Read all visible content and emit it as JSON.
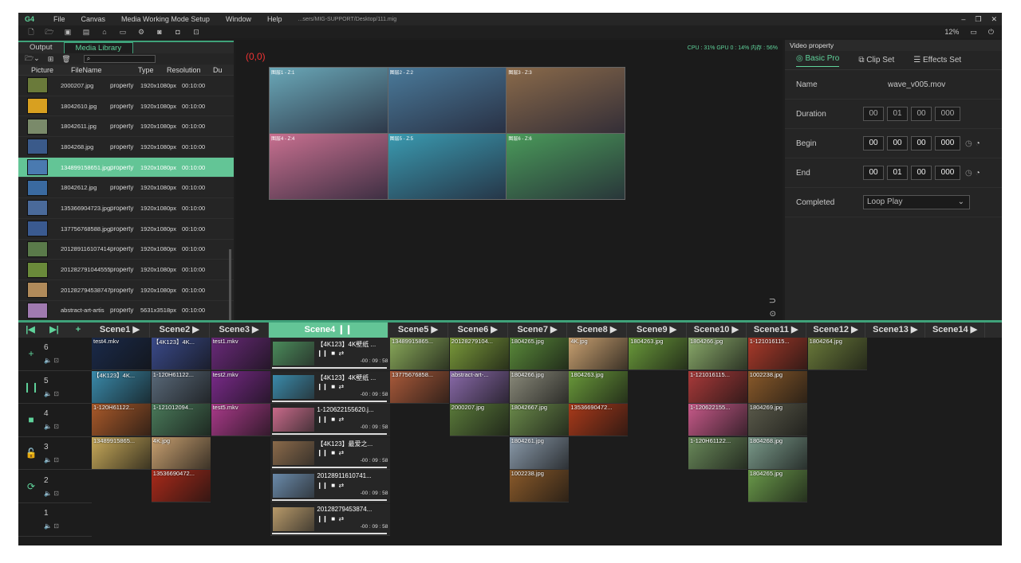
{
  "menu": {
    "app": "G4",
    "items": [
      "File",
      "Canvas",
      "Media Working Mode Setup",
      "Window",
      "Help"
    ],
    "path": "...sers/MIG-SUPPORT/Desktop/111.mig"
  },
  "toolbar": {
    "zoom": "12%"
  },
  "library": {
    "tabs": [
      "Output",
      "Media Library"
    ],
    "columns": [
      "Picture",
      "FileName",
      "Type",
      "Resolution",
      "Du"
    ],
    "rows": [
      {
        "name": "2000207.jpg",
        "type": "property",
        "res": "1920x1080px",
        "dur": "00:10:00",
        "color": "#6a7a3a"
      },
      {
        "name": "18042610.jpg",
        "type": "property",
        "res": "1920x1080px",
        "dur": "00:10:00",
        "color": "#d8a020"
      },
      {
        "name": "18042611.jpg",
        "type": "property",
        "res": "1920x1080px",
        "dur": "00:10:00",
        "color": "#7a8a6a"
      },
      {
        "name": "1804268.jpg",
        "type": "property",
        "res": "1920x1080px",
        "dur": "00:10:00",
        "color": "#3a5a8a"
      },
      {
        "name": "134899158651.jpg",
        "type": "property",
        "res": "1920x1080px",
        "dur": "00:10:00",
        "color": "#4a7ab0"
      },
      {
        "name": "18042612.jpg",
        "type": "property",
        "res": "1920x1080px",
        "dur": "00:10:00",
        "color": "#3a6aa0"
      },
      {
        "name": "135366904723.jpg",
        "type": "property",
        "res": "1920x1080px",
        "dur": "00:10:00",
        "color": "#4a6a9a"
      },
      {
        "name": "137756768588.jpg",
        "type": "property",
        "res": "1920x1080px",
        "dur": "00:10:00",
        "color": "#3a5a90"
      },
      {
        "name": "201289116107414",
        "type": "property",
        "res": "1920x1080px",
        "dur": "00:10:00",
        "color": "#5a7a4a"
      },
      {
        "name": "201282791044555",
        "type": "property",
        "res": "1920x1080px",
        "dur": "00:10:00",
        "color": "#6a8a3a"
      },
      {
        "name": "201282794538747",
        "type": "property",
        "res": "1920x1080px",
        "dur": "00:10:00",
        "color": "#b08a5a"
      },
      {
        "name": "abstract-art-artis",
        "type": "property",
        "res": "5631x3518px",
        "dur": "00:10:00",
        "color": "#a07ab0"
      }
    ]
  },
  "preview": {
    "stats": "CPU : 31%   GPU 0 : 14%   内存 : 56%",
    "origin": "(0,0)",
    "cells": [
      {
        "label": "图层1 - Z:1",
        "color": "#6aa8b8"
      },
      {
        "label": "图层2 - Z:2",
        "color": "#4a7a9a"
      },
      {
        "label": "图层3 - Z:3",
        "color": "#8a6a4a"
      },
      {
        "label": "图层4 - Z:4",
        "color": "#c87090"
      },
      {
        "label": "图层5 - Z:5",
        "color": "#3a9ab0"
      },
      {
        "label": "图层6 - Z:6",
        "color": "#4a9a5a"
      }
    ]
  },
  "property": {
    "title": "Video property",
    "tabs": [
      "Basic Pro",
      "Clip Set",
      "Effects Set"
    ],
    "name_label": "Name",
    "name_value": "wave_v005.mov",
    "duration_label": "Duration",
    "duration": [
      "00",
      "01",
      "00",
      "000"
    ],
    "begin_label": "Begin",
    "begin": [
      "00",
      "00",
      "00",
      "000"
    ],
    "end_label": "End",
    "end": [
      "00",
      "01",
      "00",
      "000"
    ],
    "completed_label": "Completed",
    "completed_value": "Loop Play"
  },
  "timeline": {
    "scenes": [
      "Scene1 ▶",
      "Scene2 ▶",
      "Scene3 ▶",
      "Scene4 ❙❙",
      "Scene5 ▶",
      "Scene6 ▶",
      "Scene7 ▶",
      "Scene8 ▶",
      "Scene9 ▶",
      "Scene10 ▶",
      "Scene11 ▶",
      "Scene12 ▶",
      "Scene13 ▶",
      "Scene14 ▶"
    ],
    "layers": [
      "6",
      "5",
      "4",
      "3",
      "2",
      "1"
    ],
    "clips": [
      {
        "r": 0,
        "c": 0,
        "t": "test4.mkv",
        "col": "#1a2a4a"
      },
      {
        "r": 0,
        "c": 1,
        "t": "【4K123】4K...",
        "col": "#3a4a8a"
      },
      {
        "r": 0,
        "c": 2,
        "t": "test1.mkv",
        "col": "#6a2a7a"
      },
      {
        "r": 0,
        "c": 4,
        "t": "13489915865...",
        "col": "#8aaa5a"
      },
      {
        "r": 0,
        "c": 5,
        "t": "20128279104...",
        "col": "#7a9a3a"
      },
      {
        "r": 0,
        "c": 6,
        "t": "1804265.jpg",
        "col": "#5a8a3a"
      },
      {
        "r": 0,
        "c": 7,
        "t": "4K.jpg",
        "col": "#c8a070"
      },
      {
        "r": 0,
        "c": 8,
        "t": "1804263.jpg",
        "col": "#6a9a3a"
      },
      {
        "r": 0,
        "c": 9,
        "t": "1804266.jpg",
        "col": "#8aaa6a"
      },
      {
        "r": 0,
        "c": 10,
        "t": "1-121016115...",
        "col": "#aa3a2a"
      },
      {
        "r": 0,
        "c": 11,
        "t": "1804264.jpg",
        "col": "#6a7a3a"
      },
      {
        "r": 1,
        "c": 0,
        "t": "【4K123】4K...",
        "col": "#3a8aaa"
      },
      {
        "r": 1,
        "c": 1,
        "t": "1-120H61122...",
        "col": "#5a6a7a"
      },
      {
        "r": 1,
        "c": 2,
        "t": "test2.mkv",
        "col": "#7a2a8a"
      },
      {
        "r": 1,
        "c": 4,
        "t": "13775676858...",
        "col": "#aa5a3a"
      },
      {
        "r": 1,
        "c": 5,
        "t": "abstract-art-...",
        "col": "#8a6aaa"
      },
      {
        "r": 1,
        "c": 6,
        "t": "1804266.jpg",
        "col": "#8a8a7a"
      },
      {
        "r": 1,
        "c": 7,
        "t": "1804263.jpg",
        "col": "#6a9a3a"
      },
      {
        "r": 1,
        "c": 9,
        "t": "1-121016115...",
        "col": "#aa3a3a"
      },
      {
        "r": 1,
        "c": 10,
        "t": "1002238.jpg",
        "col": "#8a5a2a"
      },
      {
        "r": 2,
        "c": 0,
        "t": "1-120H61122...",
        "col": "#aa5a2a"
      },
      {
        "r": 2,
        "c": 1,
        "t": "1-121012094...",
        "col": "#4a7a5a"
      },
      {
        "r": 2,
        "c": 2,
        "t": "test5.mkv",
        "col": "#aa3a8a"
      },
      {
        "r": 2,
        "c": 5,
        "t": "2000207.jpg",
        "col": "#5a7a3a"
      },
      {
        "r": 2,
        "c": 6,
        "t": "18042667.jpg",
        "col": "#6a8a4a"
      },
      {
        "r": 2,
        "c": 7,
        "t": "13536690472...",
        "col": "#aa3a1a"
      },
      {
        "r": 2,
        "c": 9,
        "t": "1-120622155...",
        "col": "#c85a8a"
      },
      {
        "r": 2,
        "c": 10,
        "t": "1804269.jpg",
        "col": "#5a5a4a"
      },
      {
        "r": 3,
        "c": 0,
        "t": "13489915865...",
        "col": "#c8aa5a"
      },
      {
        "r": 3,
        "c": 1,
        "t": "4K.jpg",
        "col": "#c8a070"
      },
      {
        "r": 3,
        "c": 6,
        "t": "1804261.jpg",
        "col": "#8a9aaa"
      },
      {
        "r": 3,
        "c": 9,
        "t": "1-120H61122...",
        "col": "#6a8a5a"
      },
      {
        "r": 3,
        "c": 10,
        "t": "1804268.jpg",
        "col": "#7a9a8a"
      },
      {
        "r": 4,
        "c": 1,
        "t": "13536690472...",
        "col": "#aa2a1a"
      },
      {
        "r": 4,
        "c": 6,
        "t": "1002238.jpg",
        "col": "#8a5a2a"
      },
      {
        "r": 4,
        "c": 10,
        "t": "1804265.jpg",
        "col": "#6a9a4a"
      }
    ],
    "active": [
      {
        "name": "【4K123】4K壁纸 ...",
        "time": "-00 : 09 : 58",
        "col": "#4a8a5a"
      },
      {
        "name": "【4K123】4K壁纸 ...",
        "time": "-00 : 09 : 58",
        "col": "#3a8aaa"
      },
      {
        "name": "1-120622155620.j...",
        "time": "-00 : 09 : 58",
        "col": "#c86a8a"
      },
      {
        "name": "【4K123】最爱之...",
        "time": "-00 : 09 : 58",
        "col": "#8a6a4a"
      },
      {
        "name": "20128911610741...",
        "time": "-00 : 09 : 58",
        "col": "#6a8aaa"
      },
      {
        "name": "20128279453874...",
        "time": "-00 : 09 : 58",
        "col": "#b89a6a"
      }
    ]
  }
}
